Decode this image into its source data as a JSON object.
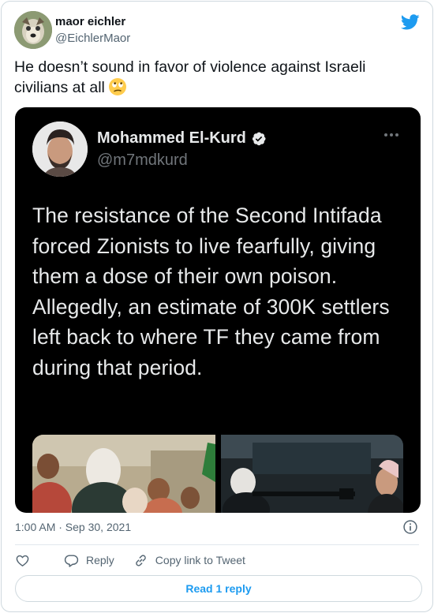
{
  "tweet": {
    "author_name": "maor eichler",
    "author_handle": "@EichlerMaor",
    "text": "He doesn’t sound in favor of violence against Israeli civilians at all",
    "emoji": "face-with-rolling-eyes",
    "timestamp": "1:00 AM · Sep 30, 2021"
  },
  "quoted": {
    "author_name": "Mohammed El-Kurd",
    "author_handle": "@m7mdkurd",
    "verified": true,
    "text": "The resistance of the Second Intifada forced Zionists to live fearfully, giving them a dose of their own poison. Allegedly, an estimate of 300K settlers left back to where TF they came from during that period."
  },
  "actions": {
    "reply_label": "Reply",
    "copy_label": "Copy link to Tweet",
    "read_replies_label": "Read 1 reply"
  },
  "icons": [
    "twitter-bird-icon",
    "verified-badge-icon",
    "more-icon",
    "info-icon",
    "heart-icon",
    "reply-icon",
    "link-icon"
  ],
  "colors": {
    "brand": "#1d9bf0",
    "text": "#0f1419",
    "secondary": "#536471",
    "dark_bg": "#000000"
  }
}
